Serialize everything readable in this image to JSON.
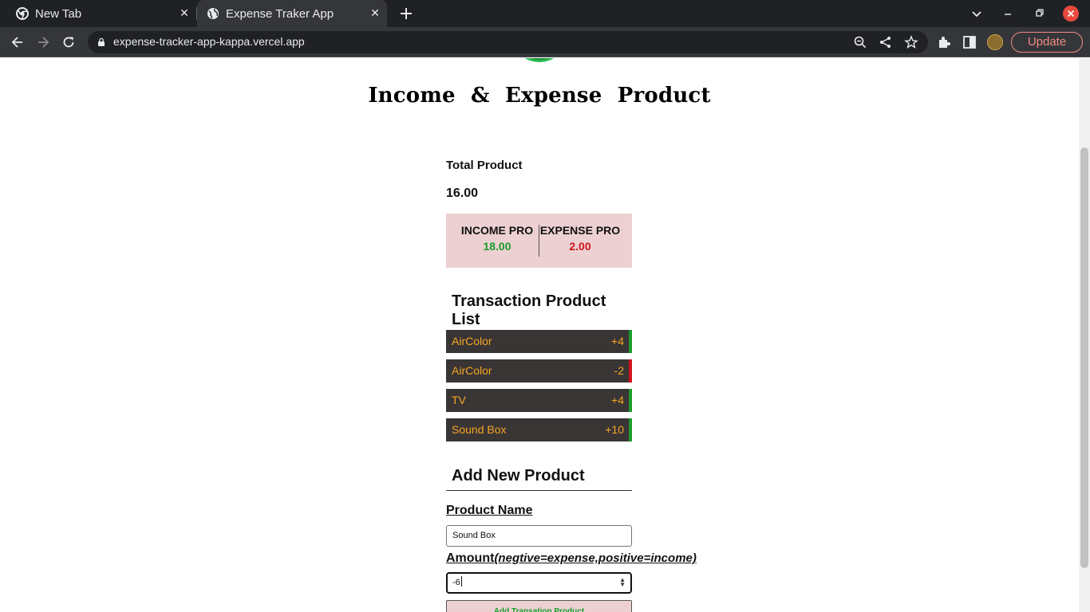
{
  "browser": {
    "tabs": [
      {
        "title": "New Tab",
        "icon": "chrome-icon",
        "active": false
      },
      {
        "title": "Expense Traker App",
        "icon": "globe-icon",
        "active": true
      }
    ],
    "url": "expense-tracker-app-kappa.vercel.app",
    "update_label": "Update"
  },
  "page": {
    "title": "Income & Expense Product",
    "total_label": "Total Product",
    "total_value": "16.00",
    "income_label": "INCOME PRO",
    "income_value": "18.00",
    "expense_label": "EXPENSE PRO",
    "expense_value": "2.00",
    "list_heading": "Transaction Product List",
    "transactions": [
      {
        "name": "AirColor",
        "amount": "+4",
        "type": "income"
      },
      {
        "name": "AirColor",
        "amount": "-2",
        "type": "expense"
      },
      {
        "name": "TV",
        "amount": "+4",
        "type": "income"
      },
      {
        "name": "Sound Box",
        "amount": "+10",
        "type": "income"
      }
    ],
    "add_heading": "Add New Product",
    "name_label": "Product Name",
    "name_value": "Sound Box",
    "amount_label": "Amount",
    "amount_hint": "(negtive=expense,positive=income)",
    "amount_value": "-6",
    "submit_label": "Add Transation Product"
  },
  "colors": {
    "income": "#1a9c2a",
    "expense": "#d0141e",
    "item_text": "#f5a623",
    "item_bg": "#3a3535",
    "card_bg": "#ecd0d2"
  }
}
